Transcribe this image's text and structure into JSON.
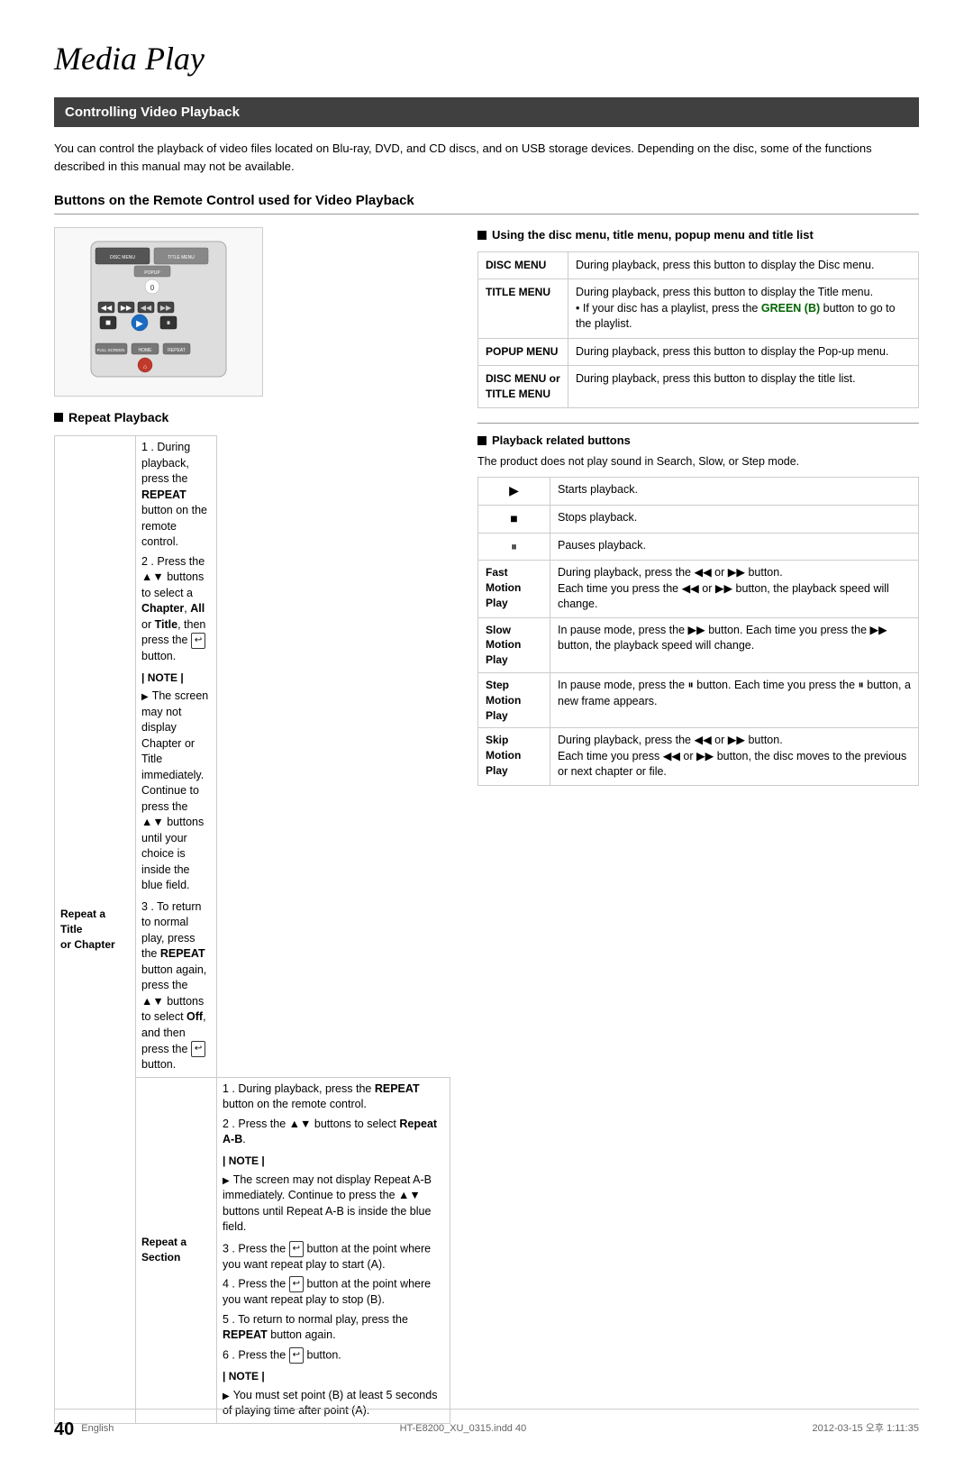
{
  "page": {
    "title": "Media Play",
    "section_header": "Controlling Video Playback",
    "intro": "You can control the playback of video files located on Blu-ray, DVD, and CD discs, and on USB storage devices. Depending on the disc, some of the functions described in this manual may not be available.",
    "buttons_heading": "Buttons on the Remote Control used for Video Playback",
    "using_menu_heading": "Using the disc menu, title menu, popup menu and title list",
    "repeat_playback_heading": "Repeat Playback",
    "playback_related_heading": "Playback related buttons",
    "playback_note": "The product does not play sound in Search, Slow, or Step mode."
  },
  "menu_items": [
    {
      "label": "DISC MENU",
      "desc": "During playback, press this button to display the Disc menu."
    },
    {
      "label": "TITLE MENU",
      "desc": "During playback, press this button to display the Title menu.\n• If your disc has a playlist, press the GREEN (B) button to go to the playlist."
    },
    {
      "label": "POPUP MENU",
      "desc": "During playback, press this button to display the Pop-up menu."
    },
    {
      "label": "DISC MENU or TITLE MENU",
      "desc": "During playback, press this button to display the title list."
    }
  ],
  "playback_buttons": [
    {
      "icon": "play",
      "label": "",
      "desc": "Starts playback."
    },
    {
      "icon": "stop",
      "label": "",
      "desc": "Stops playback."
    },
    {
      "icon": "pause",
      "label": "",
      "desc": "Pauses playback."
    },
    {
      "icon": "fast",
      "label": "Fast Motion Play",
      "desc": "During playback, press the ◀◀ or ▶▶ button.\nEach time you press the ◀◀ or ▶▶ button, the playback speed will change."
    },
    {
      "icon": "slow",
      "label": "Slow Motion Play",
      "desc": "In pause mode, press the ▶▶ button. Each time you press the ▶▶ button, the playback speed will change."
    },
    {
      "icon": "step",
      "label": "Step Motion Play",
      "desc": "In pause mode, press the ⏸ button. Each time you press the ⏸ button, a new frame appears."
    },
    {
      "icon": "skip",
      "label": "Skip Motion Play",
      "desc": "During playback, press the ◀◀ or ▶▶ button.\nEach time you press ◀◀ or ▶▶ button, the disc moves to the previous or next chapter or file."
    }
  ],
  "repeat_title_steps": [
    "During playback, press the REPEAT button on the remote control.",
    "Press the ▲▼ buttons to select a Chapter, All or Title, then press the  button.",
    "To return to normal play, press the REPEAT button again, press the ▲▼ buttons to select Off, and then press the  button."
  ],
  "repeat_title_note": "The screen may not display Chapter or Title immediately. Continue to press the ▲▼ buttons until your choice is inside the blue field.",
  "repeat_section_steps": [
    "During playback, press the REPEAT button on the remote control.",
    "Press the ▲▼ buttons to select Repeat A-B.",
    "Press the  button at the point where you want repeat play to start (A).",
    "Press the  button at the point where you want repeat play to stop (B).",
    "To return to normal play, press the REPEAT button again.",
    "Press the  button."
  ],
  "repeat_section_note": "The screen may not display Repeat A-B immediately. Continue to press the ▲▼ buttons until Repeat A-B is inside the blue field.",
  "repeat_section_note2": "You must set point (B) at least 5 seconds of playing time after point (A).",
  "footer": {
    "page_number": "40",
    "lang": "English",
    "file": "HT-E8200_XU_0315.indd  40",
    "date": "2012-03-15  오후 1:11:35"
  }
}
